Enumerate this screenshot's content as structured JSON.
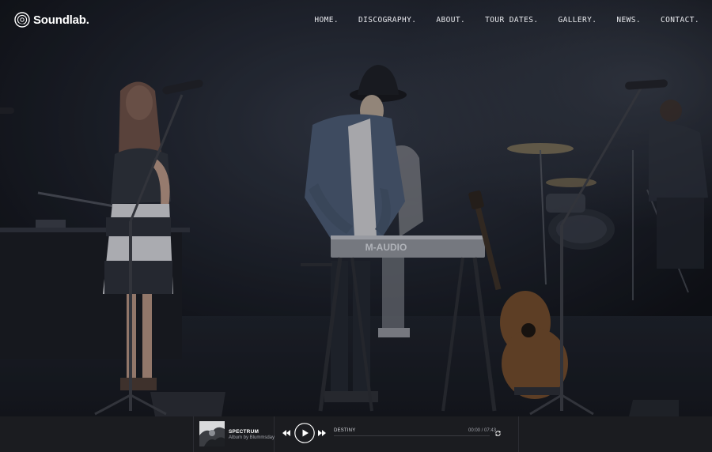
{
  "brand": {
    "name": "Soundlab.",
    "logo_icon": "vinyl-disc-icon"
  },
  "nav": {
    "items": [
      {
        "label": "HOME."
      },
      {
        "label": "DISCOGRAPHY."
      },
      {
        "label": "ABOUT."
      },
      {
        "label": "TOUR DATES."
      },
      {
        "label": "GALLERY."
      },
      {
        "label": "NEWS."
      },
      {
        "label": "CONTACT."
      }
    ]
  },
  "hero": {
    "image": "live-band-stage-photo",
    "keyboard_brand": "M-AUDIO"
  },
  "player": {
    "album_title": "SPECTRUM",
    "album_subtitle": "Album by Blummsday",
    "track_name": "DESTINY",
    "time_display": "00:00 / 07:43",
    "progress": 0,
    "icons": {
      "prev": "rewind-icon",
      "play": "play-icon",
      "next": "fast-forward-icon",
      "repeat": "repeat-icon"
    }
  },
  "colors": {
    "player_bg": "#1b1c20",
    "nav_text": "#e9eaee",
    "stage_bg": "#1a1e27"
  }
}
